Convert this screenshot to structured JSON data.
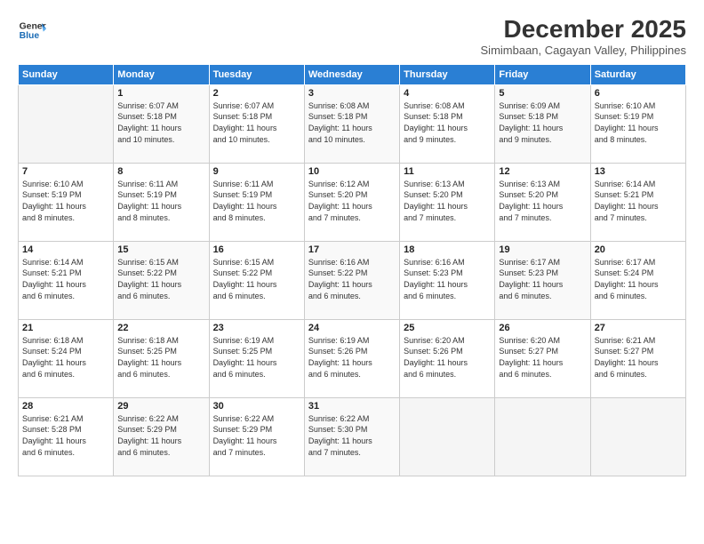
{
  "logo": {
    "line1": "General",
    "line2": "Blue"
  },
  "title": "December 2025",
  "subtitle": "Simimbaan, Cagayan Valley, Philippines",
  "days_of_week": [
    "Sunday",
    "Monday",
    "Tuesday",
    "Wednesday",
    "Thursday",
    "Friday",
    "Saturday"
  ],
  "weeks": [
    [
      {
        "day": "",
        "info": ""
      },
      {
        "day": "1",
        "info": "Sunrise: 6:07 AM\nSunset: 5:18 PM\nDaylight: 11 hours\nand 10 minutes."
      },
      {
        "day": "2",
        "info": "Sunrise: 6:07 AM\nSunset: 5:18 PM\nDaylight: 11 hours\nand 10 minutes."
      },
      {
        "day": "3",
        "info": "Sunrise: 6:08 AM\nSunset: 5:18 PM\nDaylight: 11 hours\nand 10 minutes."
      },
      {
        "day": "4",
        "info": "Sunrise: 6:08 AM\nSunset: 5:18 PM\nDaylight: 11 hours\nand 9 minutes."
      },
      {
        "day": "5",
        "info": "Sunrise: 6:09 AM\nSunset: 5:18 PM\nDaylight: 11 hours\nand 9 minutes."
      },
      {
        "day": "6",
        "info": "Sunrise: 6:10 AM\nSunset: 5:19 PM\nDaylight: 11 hours\nand 8 minutes."
      }
    ],
    [
      {
        "day": "7",
        "info": "Sunrise: 6:10 AM\nSunset: 5:19 PM\nDaylight: 11 hours\nand 8 minutes."
      },
      {
        "day": "8",
        "info": "Sunrise: 6:11 AM\nSunset: 5:19 PM\nDaylight: 11 hours\nand 8 minutes."
      },
      {
        "day": "9",
        "info": "Sunrise: 6:11 AM\nSunset: 5:19 PM\nDaylight: 11 hours\nand 8 minutes."
      },
      {
        "day": "10",
        "info": "Sunrise: 6:12 AM\nSunset: 5:20 PM\nDaylight: 11 hours\nand 7 minutes."
      },
      {
        "day": "11",
        "info": "Sunrise: 6:13 AM\nSunset: 5:20 PM\nDaylight: 11 hours\nand 7 minutes."
      },
      {
        "day": "12",
        "info": "Sunrise: 6:13 AM\nSunset: 5:20 PM\nDaylight: 11 hours\nand 7 minutes."
      },
      {
        "day": "13",
        "info": "Sunrise: 6:14 AM\nSunset: 5:21 PM\nDaylight: 11 hours\nand 7 minutes."
      }
    ],
    [
      {
        "day": "14",
        "info": "Sunrise: 6:14 AM\nSunset: 5:21 PM\nDaylight: 11 hours\nand 6 minutes."
      },
      {
        "day": "15",
        "info": "Sunrise: 6:15 AM\nSunset: 5:22 PM\nDaylight: 11 hours\nand 6 minutes."
      },
      {
        "day": "16",
        "info": "Sunrise: 6:15 AM\nSunset: 5:22 PM\nDaylight: 11 hours\nand 6 minutes."
      },
      {
        "day": "17",
        "info": "Sunrise: 6:16 AM\nSunset: 5:22 PM\nDaylight: 11 hours\nand 6 minutes."
      },
      {
        "day": "18",
        "info": "Sunrise: 6:16 AM\nSunset: 5:23 PM\nDaylight: 11 hours\nand 6 minutes."
      },
      {
        "day": "19",
        "info": "Sunrise: 6:17 AM\nSunset: 5:23 PM\nDaylight: 11 hours\nand 6 minutes."
      },
      {
        "day": "20",
        "info": "Sunrise: 6:17 AM\nSunset: 5:24 PM\nDaylight: 11 hours\nand 6 minutes."
      }
    ],
    [
      {
        "day": "21",
        "info": "Sunrise: 6:18 AM\nSunset: 5:24 PM\nDaylight: 11 hours\nand 6 minutes."
      },
      {
        "day": "22",
        "info": "Sunrise: 6:18 AM\nSunset: 5:25 PM\nDaylight: 11 hours\nand 6 minutes."
      },
      {
        "day": "23",
        "info": "Sunrise: 6:19 AM\nSunset: 5:25 PM\nDaylight: 11 hours\nand 6 minutes."
      },
      {
        "day": "24",
        "info": "Sunrise: 6:19 AM\nSunset: 5:26 PM\nDaylight: 11 hours\nand 6 minutes."
      },
      {
        "day": "25",
        "info": "Sunrise: 6:20 AM\nSunset: 5:26 PM\nDaylight: 11 hours\nand 6 minutes."
      },
      {
        "day": "26",
        "info": "Sunrise: 6:20 AM\nSunset: 5:27 PM\nDaylight: 11 hours\nand 6 minutes."
      },
      {
        "day": "27",
        "info": "Sunrise: 6:21 AM\nSunset: 5:27 PM\nDaylight: 11 hours\nand 6 minutes."
      }
    ],
    [
      {
        "day": "28",
        "info": "Sunrise: 6:21 AM\nSunset: 5:28 PM\nDaylight: 11 hours\nand 6 minutes."
      },
      {
        "day": "29",
        "info": "Sunrise: 6:22 AM\nSunset: 5:29 PM\nDaylight: 11 hours\nand 6 minutes."
      },
      {
        "day": "30",
        "info": "Sunrise: 6:22 AM\nSunset: 5:29 PM\nDaylight: 11 hours\nand 7 minutes."
      },
      {
        "day": "31",
        "info": "Sunrise: 6:22 AM\nSunset: 5:30 PM\nDaylight: 11 hours\nand 7 minutes."
      },
      {
        "day": "",
        "info": ""
      },
      {
        "day": "",
        "info": ""
      },
      {
        "day": "",
        "info": ""
      }
    ]
  ]
}
